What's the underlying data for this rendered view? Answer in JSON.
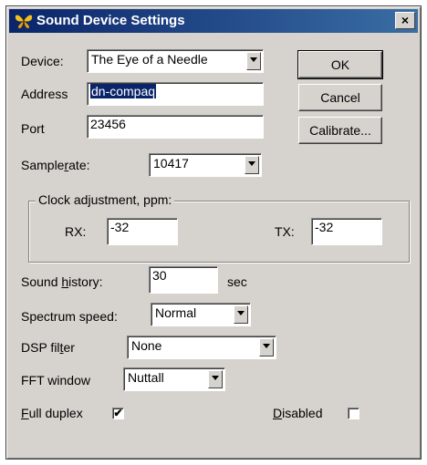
{
  "window": {
    "title": "Sound Device Settings",
    "close_label": "×"
  },
  "labels": {
    "device": "Device:",
    "address": "Address",
    "port": "Port",
    "samplerate_pre": "Sample",
    "samplerate_key": "r",
    "samplerate_post": "ate:",
    "clock_group": "Clock adjustment, ppm:",
    "rx": "RX:",
    "tx": "TX:",
    "history_pre": "Sound ",
    "history_key": "h",
    "history_post": "istory:",
    "history_unit": "sec",
    "spectrum": "Spectrum speed:",
    "dsp_pre": "DSP fil",
    "dsp_key": "t",
    "dsp_post": "er",
    "fft": "FFT window",
    "full_key": "F",
    "full_post": "ull duplex",
    "disabled_key": "D",
    "disabled_post": "isabled"
  },
  "values": {
    "device": "The Eye of a Needle",
    "address": "dn-compaq",
    "port": "23456",
    "samplerate": "10417",
    "rx": "-32",
    "tx": "-32",
    "history": "30",
    "spectrum": "Normal",
    "dsp": "None",
    "fft": "Nuttall",
    "full_duplex_mark": "✔",
    "disabled_mark": ""
  },
  "buttons": {
    "ok": "OK",
    "cancel": "Cancel",
    "calibrate": "Calibrate..."
  },
  "colors": {
    "titlebar": "#0a246a",
    "face": "#d6d3ce",
    "selection": "#0a246a"
  }
}
